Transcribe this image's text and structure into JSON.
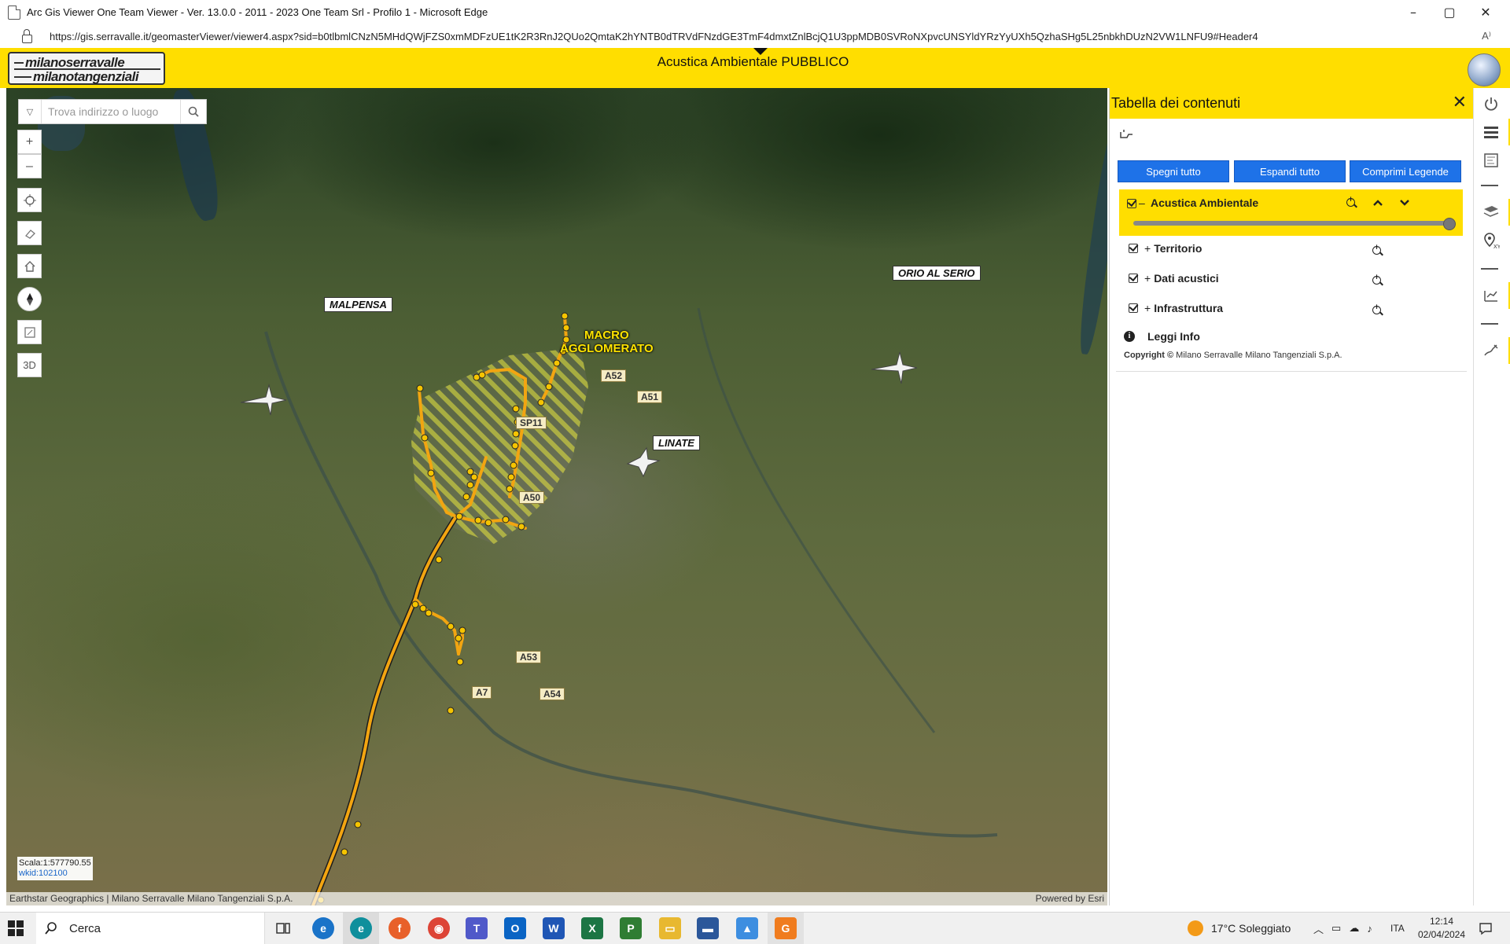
{
  "window": {
    "title": "Arc Gis Viewer One Team Viewer - Ver. 13.0.0 - 2011 - 2023 One Team Srl - Profilo 1 - Microsoft Edge",
    "controls": [
      "–",
      "▢",
      "✕"
    ]
  },
  "address": {
    "url": "https://gis.serravalle.it/geomasterViewer/viewer4.aspx?sid=b0tlbmlCNzN5MHdQWjFZS0xmMDFzUE1tK2R3RnJ2QUo2QmtaK2hYNTB0dTRVdFNzdGE3TmF4dmxtZnlBcjQ1U3ppMDB0SVRoNXpvcUNSYldYRzYyUXh5QzhaSHg5L25nbkhDUzN2VW1LNFU9#Header4",
    "read_aloud": "A⁾"
  },
  "app": {
    "logo_line1": "milanoserravalle",
    "logo_line2": "milanotangenziali",
    "title": "Acustica Ambientale PUBBLICO"
  },
  "map": {
    "search_placeholder": "Trova indirizzo o luogo",
    "tools": {
      "zoom_in": "+",
      "zoom_out": "–",
      "three_d": "3D"
    },
    "scale": "Scala:1:577790.55",
    "wkid": "wkid:102100",
    "attribution_left": "Earthstar Geographics | Milano Serravalle Milano Tangenziali S.p.A.",
    "attribution_right": "Powered by Esri",
    "labels": {
      "malpensa": "MALPENSA",
      "orio": "ORIO AL SERIO",
      "linate": "LINATE",
      "macro1": "MACRO",
      "macro2": "AGGLOMERATO"
    },
    "roads": [
      "A52",
      "A51",
      "SP11",
      "A50",
      "A53",
      "A54",
      "A7"
    ]
  },
  "toc": {
    "title": "Tabella dei contenuti",
    "close": "✕",
    "buttons": [
      "Spegni tutto",
      "Espandi tutto",
      "Comprimi Legende"
    ],
    "main_layer": {
      "toggle": "–",
      "name": "Acustica Ambientale",
      "opacity": 1.0
    },
    "sublayers": [
      {
        "toggle": "+",
        "name": "Territorio"
      },
      {
        "toggle": "+",
        "name": "Dati acustici"
      },
      {
        "toggle": "+",
        "name": "Infrastruttura"
      }
    ],
    "info": "Leggi Info",
    "copyright_label": "Copyright ©",
    "copyright_text": "Milano Serravalle Milano Tangenziali S.p.A."
  },
  "taskbar": {
    "search": "Cerca",
    "weather": "17°C  Soleggiato",
    "lang": "ITA",
    "time": "12:14",
    "date": "02/04/2024"
  },
  "colors": {
    "brand_yellow": "#ffde00",
    "button_blue": "#1e72e8",
    "road_orange": "#f2a511"
  }
}
